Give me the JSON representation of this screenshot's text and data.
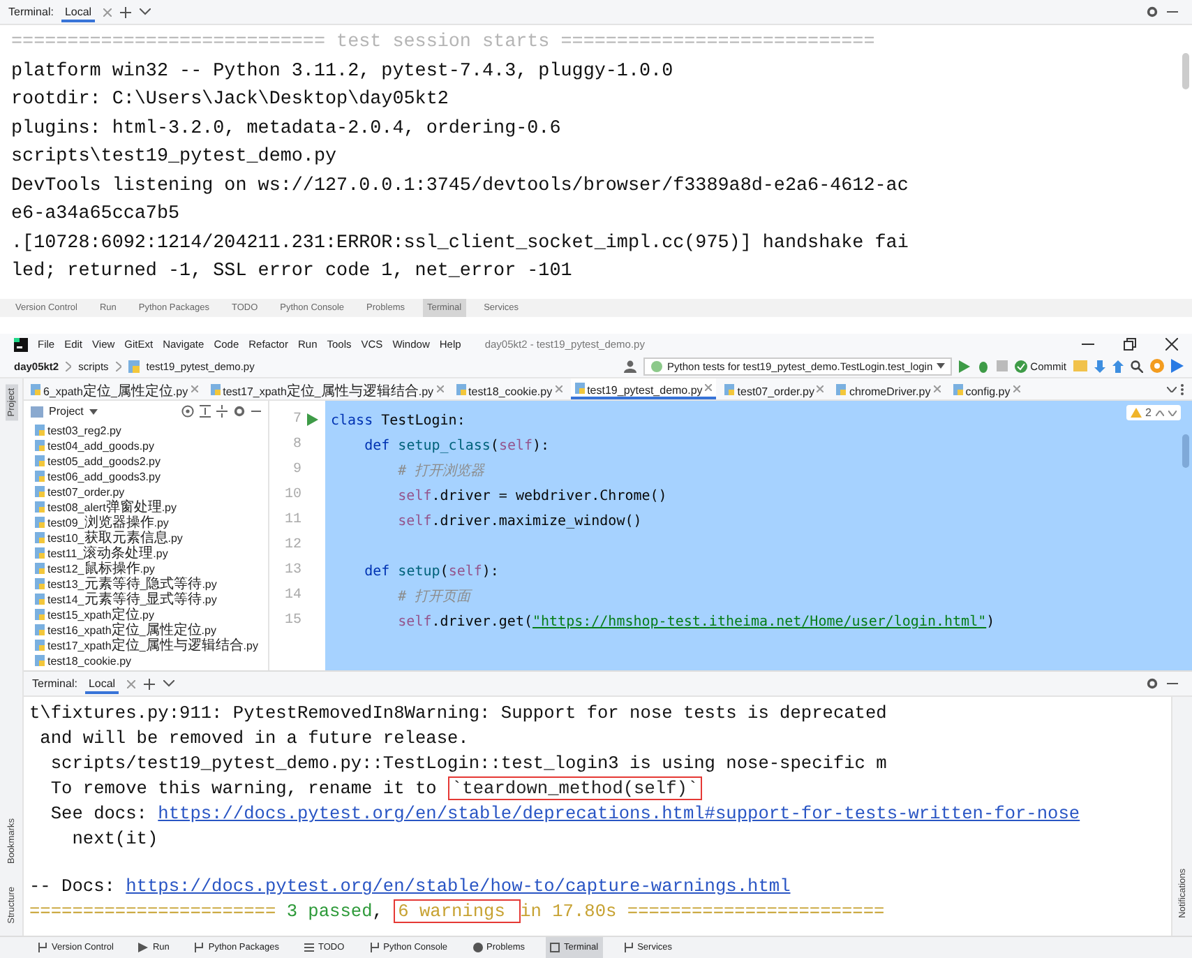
{
  "top_terminal": {
    "label": "Terminal:",
    "tab": "Local",
    "lines": [
      {
        "segments": [
          {
            "kind": "sep",
            "text": "============================ test session starts ============================"
          }
        ]
      },
      {
        "segments": [
          {
            "kind": "plain",
            "text": "platform win32 -- Python 3.11.2, pytest-7.4.3, pluggy-1.0.0"
          }
        ]
      },
      {
        "segments": [
          {
            "kind": "plain",
            "text": "rootdir: C:\\Users\\Jack\\Desktop\\day05kt2"
          }
        ]
      },
      {
        "segments": [
          {
            "kind": "plain",
            "text": "plugins: html-3.2.0, metadata-2.0.4, ordering-0.6"
          }
        ]
      },
      {
        "segments": [
          {
            "kind": "plain",
            "text": "scripts\\test19_pytest_demo.py"
          }
        ]
      },
      {
        "segments": [
          {
            "kind": "plain",
            "text": "DevTools listening on ws://127.0.0.1:3745/devtools/browser/f3389a8d-e2a6-4612-ac"
          }
        ]
      },
      {
        "segments": [
          {
            "kind": "plain",
            "text": "e6-a34a65cca7b5"
          }
        ]
      },
      {
        "segments": [
          {
            "kind": "plain",
            "text": ".[10728:6092:1214/204211.231:ERROR:ssl_client_socket_impl.cc(975)] handshake fai"
          }
        ]
      },
      {
        "segments": [
          {
            "kind": "plain",
            "text": "led; returned -1, SSL error code 1, net_error -101"
          }
        ]
      }
    ]
  },
  "tool_strip": [
    {
      "label": "Version Control",
      "selected": false
    },
    {
      "label": "Run",
      "selected": false
    },
    {
      "label": "Python Packages",
      "selected": false
    },
    {
      "label": "TODO",
      "selected": false
    },
    {
      "label": "Python Console",
      "selected": false
    },
    {
      "label": "Problems",
      "selected": false
    },
    {
      "label": "Terminal",
      "selected": true
    },
    {
      "label": "Services",
      "selected": false
    }
  ],
  "ide": {
    "menu": [
      "File",
      "Edit",
      "View",
      "GitExt",
      "Navigate",
      "Code",
      "Refactor",
      "Run",
      "Tools",
      "VCS",
      "Window",
      "Help"
    ],
    "title": "day05kt2 - test19_pytest_demo.py",
    "breadcrumb": [
      "day05kt2",
      "scripts",
      "test19_pytest_demo.py"
    ],
    "run_config": "Python tests for test19_pytest_demo.TestLogin.test_login",
    "commit": "Commit",
    "side_tabs": {
      "top_left": [
        {
          "label": "Project",
          "selected": true
        }
      ],
      "bottom_left": [
        {
          "label": "Bookmarks",
          "selected": false
        },
        {
          "label": "Structure",
          "selected": false
        }
      ],
      "right": [
        {
          "label": "Notifications",
          "selected": false
        }
      ]
    },
    "tabs": [
      {
        "label": "6_xpath定位_属性定位.py",
        "selected": false
      },
      {
        "label": "test17_xpath定位_属性与逻辑结合.py",
        "selected": false
      },
      {
        "label": "test18_cookie.py",
        "selected": false
      },
      {
        "label": "test19_pytest_demo.py",
        "selected": true
      },
      {
        "label": "test07_order.py",
        "selected": false
      },
      {
        "label": "chromeDriver.py",
        "selected": false
      },
      {
        "label": "config.py",
        "selected": false
      }
    ],
    "project": {
      "title": "Project",
      "files": [
        "test03_reg2.py",
        "test04_add_goods.py",
        "test05_add_goods2.py",
        "test06_add_goods3.py",
        "test07_order.py",
        "test08_alert弹窗处理.py",
        "test09_浏览器操作.py",
        "test10_获取元素信息.py",
        "test11_滚动条处理.py",
        "test12_鼠标操作.py",
        "test13_元素等待_隐式等待.py",
        "test14_元素等待_显式等待.py",
        "test15_xpath定位.py",
        "test16_xpath定位_属性定位.py",
        "test17_xpath定位_属性与逻辑结合.py",
        "test18_cookie.py"
      ]
    },
    "editor": {
      "selected": true,
      "warnings": "2",
      "lines": [
        {
          "number": "7",
          "run": true,
          "tokens": [
            {
              "kind": "keyword",
              "text": "class"
            },
            {
              "kind": "plain",
              "text": " TestLogin:"
            }
          ]
        },
        {
          "number": "8",
          "run": false,
          "tokens": [
            {
              "kind": "keyword",
              "text": "    def"
            },
            {
              "kind": "function",
              "text": " setup_class"
            },
            {
              "kind": "plain",
              "text": "("
            },
            {
              "kind": "self",
              "text": "self"
            },
            {
              "kind": "plain",
              "text": "):"
            }
          ]
        },
        {
          "number": "9",
          "run": false,
          "tokens": [
            {
              "kind": "comment",
              "text": "        # 打开浏览器"
            }
          ]
        },
        {
          "number": "10",
          "run": false,
          "tokens": [
            {
              "kind": "self",
              "text": "        self"
            },
            {
              "kind": "plain",
              "text": ".driver = webdriver.Chrome()"
            }
          ]
        },
        {
          "number": "11",
          "run": false,
          "tokens": [
            {
              "kind": "self",
              "text": "        self"
            },
            {
              "kind": "plain",
              "text": ".driver.maximize_window()"
            }
          ]
        },
        {
          "number": "12",
          "run": false
        },
        {
          "number": "13",
          "run": false,
          "tokens": [
            {
              "kind": "keyword",
              "text": "    def"
            },
            {
              "kind": "function",
              "text": " setup"
            },
            {
              "kind": "plain",
              "text": "("
            },
            {
              "kind": "self",
              "text": "self"
            },
            {
              "kind": "plain",
              "text": "):"
            }
          ]
        },
        {
          "number": "14",
          "run": false,
          "tokens": [
            {
              "kind": "comment",
              "text": "        # 打开页面"
            }
          ]
        },
        {
          "number": "15",
          "run": false,
          "tokens": [
            {
              "kind": "self",
              "text": "        self"
            },
            {
              "kind": "plain",
              "text": ".driver.get("
            },
            {
              "kind": "string",
              "text": "\"https://hmshop-test.itheima.net/Home/user/login.html\""
            },
            {
              "kind": "plain",
              "text": ")"
            }
          ]
        }
      ]
    },
    "terminal": {
      "label": "Terminal:",
      "tab": "Local",
      "blocks": [
        [
          {
            "segments": [
              {
                "kind": "plain",
                "text": "t\\fixtures.py:911: PytestRemovedIn8Warning: Support for nose tests is deprecated"
              }
            ]
          },
          {
            "segments": [
              {
                "kind": "plain",
                "text": " and will be removed in a future release."
              }
            ]
          },
          {
            "segments": [
              {
                "kind": "plain",
                "text": "  scripts/test19_pytest_demo.py::TestLogin::test_login3 is using nose-specific m"
              }
            ]
          },
          {
            "segments": [
              {
                "kind": "plain",
                "text": "  To remove this warning, rename it to "
              },
              {
                "kind": "boxed",
                "text": "`teardown_method(self)`"
              }
            ]
          },
          {
            "segments": [
              {
                "kind": "plain",
                "text": "  See docs: "
              },
              {
                "kind": "link",
                "text": "https://docs.pytest.org/en/stable/deprecations.html#support-for-tests-written-for-nose"
              }
            ]
          },
          {
            "segments": [
              {
                "kind": "plain",
                "text": "    next(it)"
              }
            ]
          }
        ],
        [
          {
            "segments": [
              {
                "kind": "plain",
                "text": "-- Docs: "
              },
              {
                "kind": "link",
                "text": "https://docs.pytest.org/en/stable/how-to/capture-warnings.html"
              }
            ]
          },
          {
            "segments": [
              {
                "kind": "warn",
                "text": "======================= "
              },
              {
                "kind": "pass",
                "text": "3 passed"
              },
              {
                "kind": "plain",
                "text": ", "
              },
              {
                "kind": "warnboxed",
                "text": "6 warnings "
              },
              {
                "kind": "warn",
                "text": "in 17.80s ========================"
              }
            ]
          }
        ]
      ]
    },
    "toolbar": [
      {
        "label": "Version Control",
        "selected": false
      },
      {
        "label": "Run",
        "selected": false
      },
      {
        "label": "Python Packages",
        "selected": false
      },
      {
        "label": "TODO",
        "selected": false
      },
      {
        "label": "Python Console",
        "selected": false
      },
      {
        "label": "Problems",
        "selected": false
      },
      {
        "label": "Terminal",
        "selected": true
      },
      {
        "label": "Services",
        "selected": false
      }
    ]
  }
}
